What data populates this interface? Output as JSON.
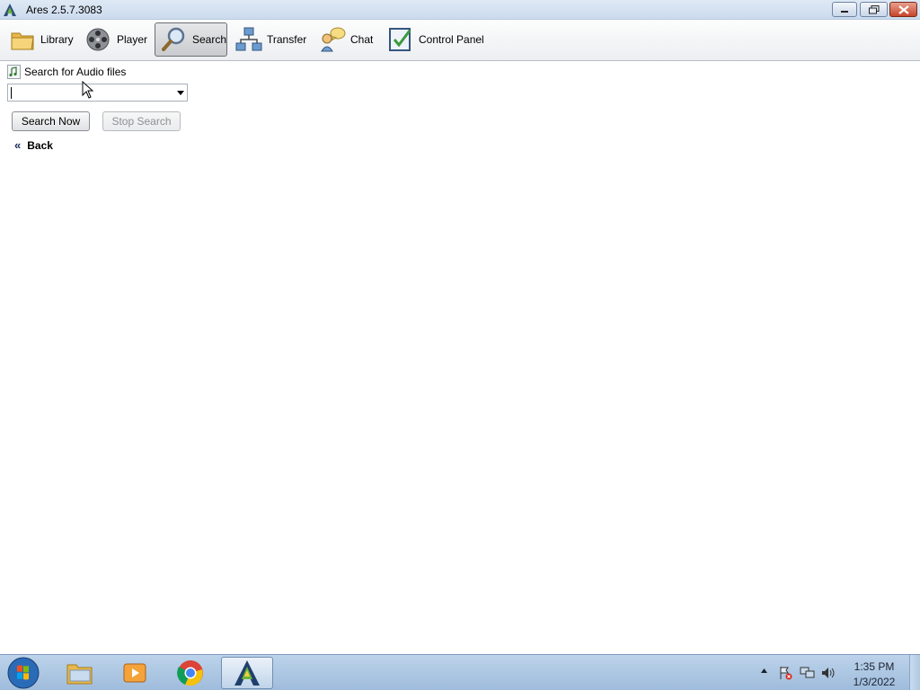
{
  "window": {
    "title": "Ares 2.5.7.3083"
  },
  "toolbar": {
    "items": [
      {
        "label": "Library",
        "icon": "folder-icon"
      },
      {
        "label": "Player",
        "icon": "film-reel-icon"
      },
      {
        "label": "Search",
        "icon": "magnifier-icon",
        "active": true
      },
      {
        "label": "Transfer",
        "icon": "network-icon"
      },
      {
        "label": "Chat",
        "icon": "chat-icon"
      },
      {
        "label": "Control Panel",
        "icon": "checklist-icon"
      }
    ]
  },
  "search_panel": {
    "heading": "Search for Audio files",
    "query_value": "",
    "search_now_label": "Search Now",
    "stop_search_label": "Stop Search",
    "back_label": "Back"
  },
  "taskbar": {
    "clock_time": "1:35 PM",
    "clock_date": "1/3/2022"
  },
  "colors": {
    "titlebar": "#cbdbee",
    "taskbar": "#a9c3df",
    "accent": "#1b2f5a"
  }
}
